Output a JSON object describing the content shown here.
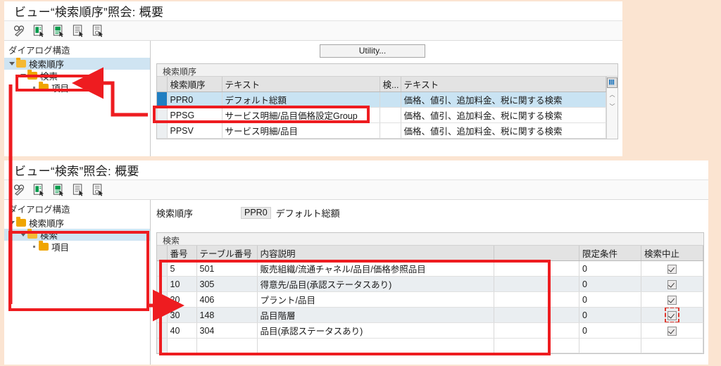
{
  "page": {
    "background": "#fbe4d1",
    "accent_annotation": "#ee1c20"
  },
  "window_top": {
    "title": "ビュー“検索順序”照会: 概要",
    "toolbar": [
      {
        "name": "display-change-icon",
        "glyph": "display-change"
      },
      {
        "name": "new-entries-icon",
        "glyph": "doc-green"
      },
      {
        "name": "copy-as-icon",
        "glyph": "doc-green"
      },
      {
        "name": "delete-icon",
        "glyph": "doc-grey"
      },
      {
        "name": "print-icon",
        "glyph": "doc-print"
      }
    ],
    "tree": {
      "header": "ダイアログ構造",
      "items": [
        {
          "label": "検索順序",
          "level": 1,
          "selected": true,
          "expanded": true
        },
        {
          "label": "検索",
          "level": 2,
          "selected": false,
          "expanded": true
        },
        {
          "label": "項目",
          "level": 3,
          "selected": false,
          "expanded": false
        }
      ]
    },
    "utility_button": "Utility...",
    "grid": {
      "caption": "検索順序",
      "columns": [
        "検索順序",
        "テキスト",
        "検...",
        "テキスト"
      ],
      "rows": [
        {
          "code": "PPR0",
          "text": "デフォルト総額",
          "sh": "",
          "sh_text": "価格、値引、追加料金、税に関する検索",
          "selected": true
        },
        {
          "code": "PPSG",
          "text": "サービス明細/品目価格設定Group",
          "sh": "",
          "sh_text": "価格、値引、追加料金、税に関する検索",
          "selected": false
        },
        {
          "code": "PPSV",
          "text": "サービス明細/品目",
          "sh": "",
          "sh_text": "価格、値引、追加料金、税に関する検索",
          "selected": false
        }
      ],
      "scroll_up": "︿",
      "scroll_down": "﹀"
    }
  },
  "window_bottom": {
    "title": "ビュー“検索”照会: 概要",
    "toolbar": [
      {
        "name": "display-change-icon",
        "glyph": "display-change"
      },
      {
        "name": "new-entries-icon",
        "glyph": "doc-green"
      },
      {
        "name": "copy-as-icon",
        "glyph": "doc-green"
      },
      {
        "name": "delete-icon",
        "glyph": "doc-grey"
      },
      {
        "name": "print-icon",
        "glyph": "doc-print"
      }
    ],
    "tree": {
      "header": "ダイアログ構造",
      "items": [
        {
          "label": "検索順序",
          "level": 1,
          "selected": false,
          "expanded": true
        },
        {
          "label": "検索",
          "level": 2,
          "selected": true,
          "expanded": true
        },
        {
          "label": "項目",
          "level": 3,
          "selected": false,
          "expanded": false
        }
      ]
    },
    "field": {
      "label": "検索順序",
      "code": "PPR0",
      "text": "デフォルト総額"
    },
    "grid": {
      "caption": "検索",
      "columns": [
        "番号",
        "テーブル番号",
        "内容説明",
        "",
        "限定条件",
        "検索中止"
      ],
      "rows": [
        {
          "no": "5",
          "table": "501",
          "desc": "販売組織/流通チャネル/品目/価格参照品目",
          "blank": "",
          "cond": "0",
          "stop_checked": true,
          "stop_focus": false
        },
        {
          "no": "10",
          "table": "305",
          "desc": "得意先/品目(承認ステータスあり)",
          "blank": "",
          "cond": "0",
          "stop_checked": true,
          "stop_focus": false
        },
        {
          "no": "20",
          "table": "406",
          "desc": "プラント/品目",
          "blank": "",
          "cond": "0",
          "stop_checked": true,
          "stop_focus": false
        },
        {
          "no": "30",
          "table": "148",
          "desc": "品目階層",
          "blank": "",
          "cond": "0",
          "stop_checked": true,
          "stop_focus": true
        },
        {
          "no": "40",
          "table": "304",
          "desc": "品目(承認ステータスあり)",
          "blank": "",
          "cond": "0",
          "stop_checked": true,
          "stop_focus": false
        }
      ]
    }
  }
}
